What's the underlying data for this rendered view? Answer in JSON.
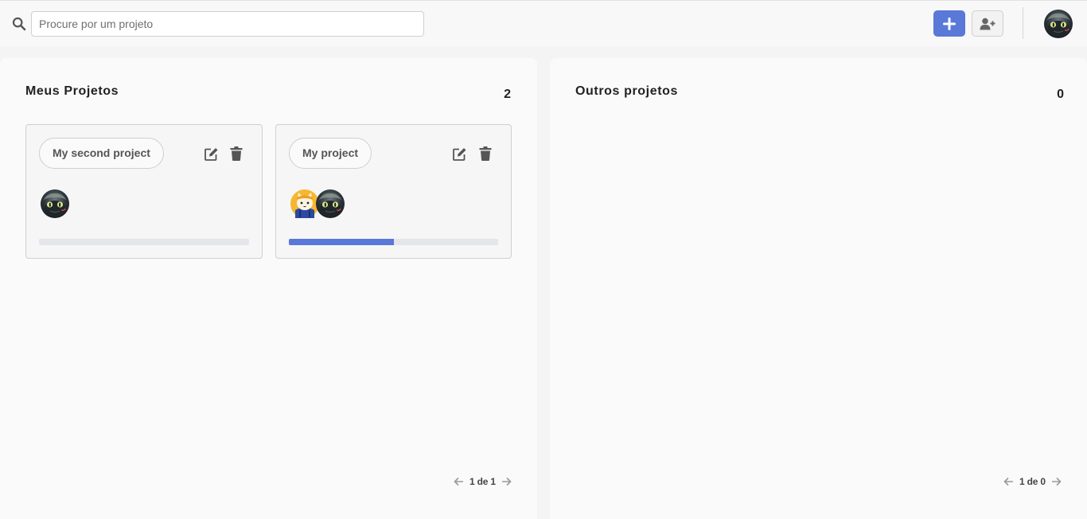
{
  "search": {
    "placeholder": "Procure por um projeto",
    "value": ""
  },
  "icons": {
    "search": "search-icon",
    "add": "plus-icon",
    "invite": "user-plus-icon",
    "edit": "edit-icon",
    "delete": "trash-icon",
    "prev": "arrow-left-icon",
    "next": "arrow-right-icon"
  },
  "colors": {
    "accent": "#5a78d8",
    "progress_track": "#e4e6ea",
    "icon": "#555555"
  },
  "my_projects": {
    "title": "Meus Projetos",
    "count": "2",
    "projects": [
      {
        "name": "My second project",
        "members": [
          "toothless-avatar"
        ],
        "progress": 0
      },
      {
        "name": "My project",
        "members": [
          "cat-avatar",
          "toothless-avatar"
        ],
        "progress": 0.5
      }
    ],
    "pagination": "1 de 1"
  },
  "other_projects": {
    "title": "Outros projetos",
    "count": "0",
    "pagination": "1 de 0"
  }
}
